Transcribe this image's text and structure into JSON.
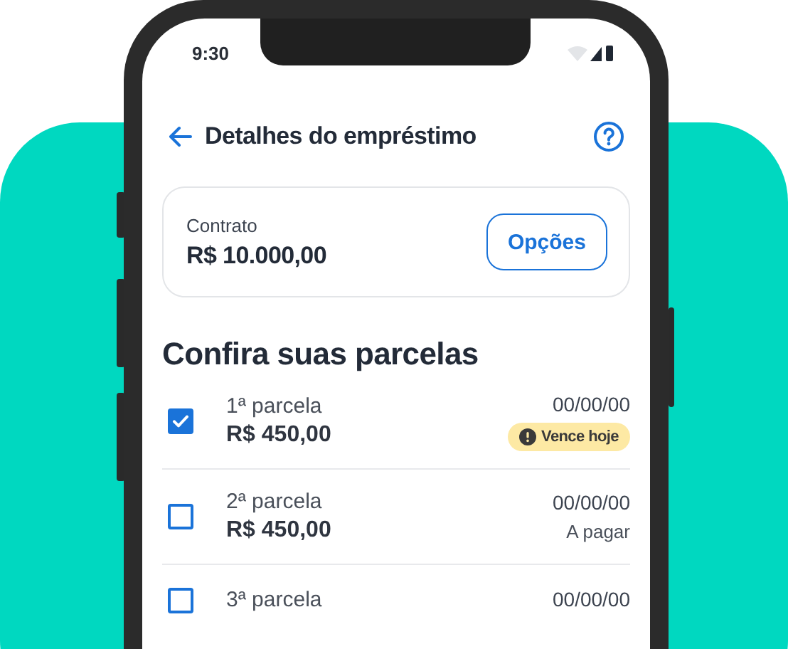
{
  "status_bar": {
    "time": "9:30"
  },
  "header": {
    "title": "Detalhes do empréstimo"
  },
  "contract": {
    "label": "Contrato",
    "amount": "R$ 10.000,00",
    "button": "Opções"
  },
  "section_title": "Confira suas parcelas",
  "installments": [
    {
      "label": "1ª parcela",
      "amount": "R$ 450,00",
      "date": "00/00/00",
      "checked": true,
      "status": {
        "kind": "badge",
        "text": "Vence hoje"
      }
    },
    {
      "label": "2ª parcela",
      "amount": "R$ 450,00",
      "date": "00/00/00",
      "checked": false,
      "status": {
        "kind": "plain",
        "text": "A pagar"
      }
    },
    {
      "label": "3ª parcela",
      "date": "00/00/00",
      "checked": false
    }
  ]
}
